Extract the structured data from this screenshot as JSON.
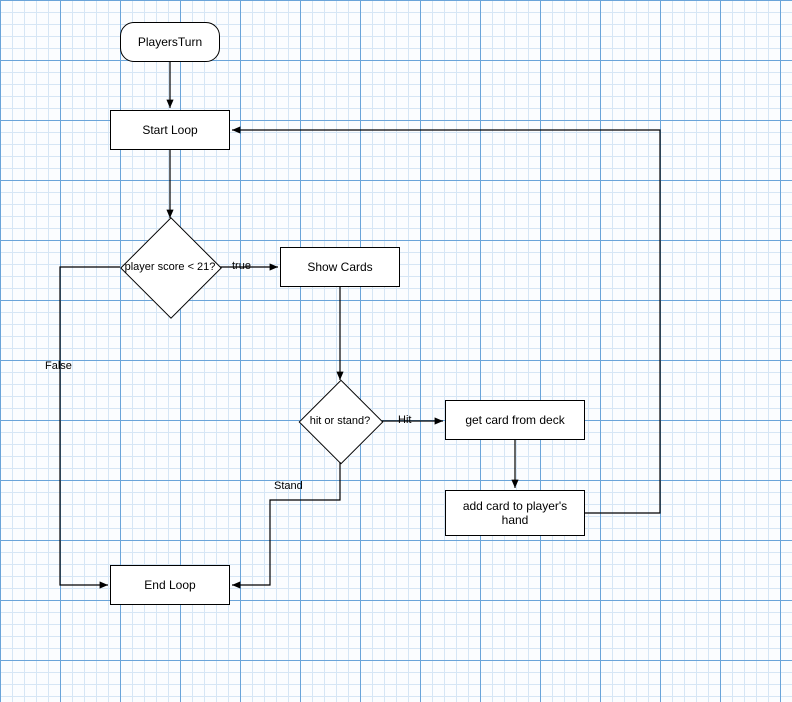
{
  "nodes": {
    "playersTurn": "PlayersTurn",
    "startLoop": "Start Loop",
    "scoreCheck": "player score < 21?",
    "showCards": "Show Cards",
    "hitStand": "hit or stand?",
    "getCard": "get card from deck",
    "addCard": "add card to player's hand",
    "endLoop": "End Loop"
  },
  "edges": {
    "trueLabel": "true",
    "falseLabel": "False",
    "hitLabel": "Hit",
    "standLabel": "Stand"
  },
  "chart_data": {
    "type": "flowchart",
    "title": "PlayersTurn",
    "nodes": [
      {
        "id": "playersTurn",
        "type": "terminator",
        "label": "PlayersTurn"
      },
      {
        "id": "startLoop",
        "type": "process",
        "label": "Start Loop"
      },
      {
        "id": "scoreCheck",
        "type": "decision",
        "label": "player score < 21?"
      },
      {
        "id": "showCards",
        "type": "process",
        "label": "Show Cards"
      },
      {
        "id": "hitStand",
        "type": "decision",
        "label": "hit or stand?"
      },
      {
        "id": "getCard",
        "type": "process",
        "label": "get card from deck"
      },
      {
        "id": "addCard",
        "type": "process",
        "label": "add card to player's hand"
      },
      {
        "id": "endLoop",
        "type": "process",
        "label": "End Loop"
      }
    ],
    "edges": [
      {
        "from": "playersTurn",
        "to": "startLoop",
        "label": ""
      },
      {
        "from": "startLoop",
        "to": "scoreCheck",
        "label": ""
      },
      {
        "from": "scoreCheck",
        "to": "showCards",
        "label": "true"
      },
      {
        "from": "scoreCheck",
        "to": "endLoop",
        "label": "False"
      },
      {
        "from": "showCards",
        "to": "hitStand",
        "label": ""
      },
      {
        "from": "hitStand",
        "to": "getCard",
        "label": "Hit"
      },
      {
        "from": "hitStand",
        "to": "endLoop",
        "label": "Stand"
      },
      {
        "from": "getCard",
        "to": "addCard",
        "label": ""
      },
      {
        "from": "addCard",
        "to": "startLoop",
        "label": ""
      }
    ]
  }
}
